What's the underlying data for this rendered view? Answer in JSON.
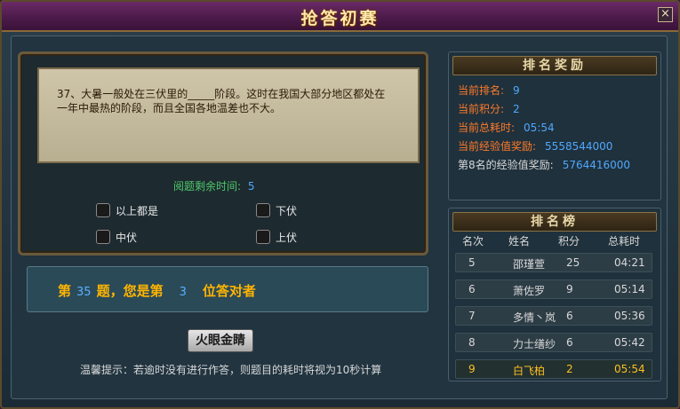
{
  "window": {
    "title": "抢答初赛",
    "close_label": "×"
  },
  "question": {
    "text": "37、大暑一般处在三伏里的_____阶段。这时在我国大部分地区都处在一年中最热的阶段，而且全国各地温差也不大。",
    "timer_label": "阅题剩余时间:",
    "timer_value": "5",
    "options": [
      "以上都是",
      "下伏",
      "中伏",
      "上伏"
    ]
  },
  "result": {
    "prefix": "第",
    "question_no": "35",
    "mid": "题，您是第",
    "rank": "3",
    "suffix": "位答对者"
  },
  "hint_button": "火眼金睛",
  "tip": "温馨提示：若逾时没有进行作答，则题目的耗时将视为10秒计算",
  "reward_panel": {
    "title": "排名奖励",
    "lines": [
      {
        "label": "当前排名:",
        "value": "9"
      },
      {
        "label": "当前积分:",
        "value": "2"
      },
      {
        "label": "当前总耗时:",
        "value": "05:54"
      },
      {
        "label": "当前经验值奖励:",
        "value": "5558544000"
      },
      {
        "label": "第8名的经验值奖励:",
        "value": "5764416000"
      }
    ]
  },
  "ranking_panel": {
    "title": "排名榜",
    "headers": [
      "名次",
      "姓名",
      "积分",
      "总耗时"
    ],
    "rows": [
      {
        "rank": "5",
        "name": "邵瑾萱",
        "score": "25",
        "time": "04:21"
      },
      {
        "rank": "6",
        "name": "萧佐罗",
        "score": "9",
        "time": "05:14"
      },
      {
        "rank": "7",
        "name": "多情丶岚",
        "score": "6",
        "time": "05:36"
      },
      {
        "rank": "8",
        "name": "力士缮纱",
        "score": "6",
        "time": "05:42"
      },
      {
        "rank": "9",
        "name": "白飞柏",
        "score": "2",
        "time": "05:54"
      }
    ]
  },
  "colors": {
    "title_gold": "#ffe9a8",
    "accent_orange": "#ff7a2a",
    "value_blue": "#4fa8ff",
    "timer_green": "#4fc86a",
    "highlight_yellow": "#ffc020"
  }
}
